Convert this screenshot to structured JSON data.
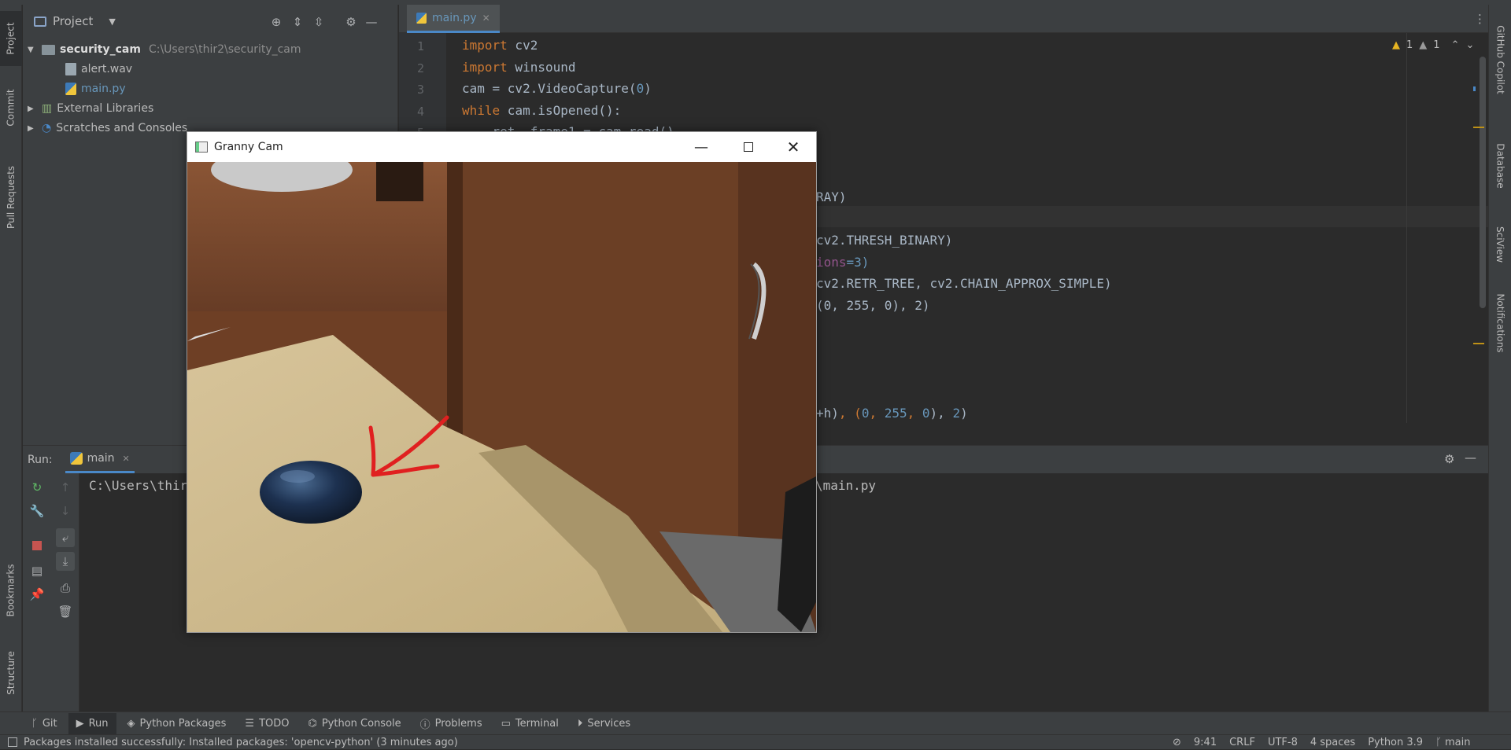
{
  "left_strip": {
    "tabs": [
      "Project",
      "Commit",
      "Pull Requests",
      "Bookmarks",
      "Structure"
    ]
  },
  "right_strip": {
    "tabs": [
      "GitHub Copilot",
      "Database",
      "SciView",
      "Notifications"
    ]
  },
  "project": {
    "title": "Project",
    "tree": {
      "root_name": "security_cam",
      "root_path": "C:\\Users\\thir2\\security_cam",
      "files": [
        "alert.wav",
        "main.py"
      ],
      "external": "External Libraries",
      "scratches": "Scratches and Consoles"
    }
  },
  "editor": {
    "tab": "main.py",
    "inspections": {
      "warnings": "1",
      "weak": "1"
    },
    "lines": [
      {
        "n": "1",
        "kw": "import",
        "rest": " cv2"
      },
      {
        "n": "2",
        "kw": "import",
        "rest": " winsound"
      },
      {
        "n": "3",
        "pre": "cam = cv2.VideoCapture(",
        "num": "0",
        "post": ")"
      },
      {
        "n": "4",
        "kw": "while",
        "rest": " cam.isOpened():"
      },
      {
        "n": "5",
        "rest": "    ret, frame1 = cam.read()"
      }
    ],
    "fragments": {
      "f1": "RAY)",
      "f2": "cv2.THRESH_BINARY)",
      "f3a": "ions",
      "f3b": "=3)",
      "f4": "cv2.RETR_TREE, cv2.CHAIN_APPROX_SIMPLE)",
      "f5": "(0, 255, 0), 2)",
      "f6a": "+h)",
      "f6b": ", (",
      "f6c": "0",
      "f6d": ", ",
      "f6e": "255",
      "f6f": ", ",
      "f6g": "0",
      "f6h": "), ",
      "f6i": "2",
      "f6j": ")"
    }
  },
  "run": {
    "label": "Run:",
    "config": "main",
    "console_left": "C:\\Users\\thir",
    "console_right": "\\main.py"
  },
  "toolbar": {
    "items": [
      "Git",
      "Run",
      "Python Packages",
      "TODO",
      "Python Console",
      "Problems",
      "Terminal",
      "Services"
    ]
  },
  "status": {
    "message": "Packages installed successfully: Installed packages: 'opencv-python' (3 minutes ago)",
    "time": "9:41",
    "line_sep": "CRLF",
    "encoding": "UTF-8",
    "indent": "4 spaces",
    "interpreter": "Python 3.9",
    "branch": "main"
  },
  "window": {
    "title": "Granny Cam"
  },
  "colors": {
    "keyword": "#cc7832",
    "number": "#6897bb",
    "accent": "#4a88c7",
    "arrow": "#e02020"
  }
}
